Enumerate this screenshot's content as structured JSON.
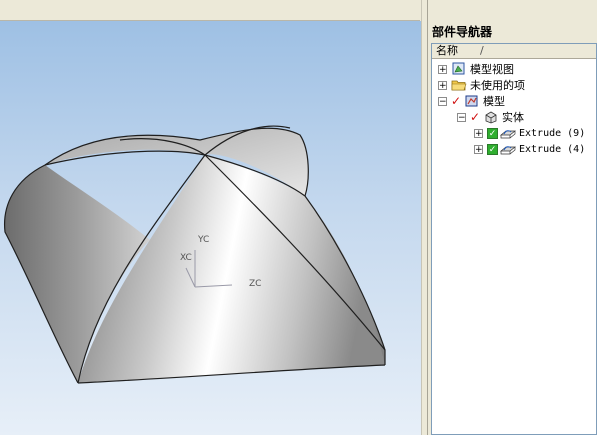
{
  "viewport": {
    "axis_labels": {
      "yc": "YC",
      "xc": "XC",
      "zc": "ZC"
    }
  },
  "navigator": {
    "title": "部件导航器",
    "column_name": "名称",
    "sort_indicator": "/",
    "items": [
      {
        "label": "模型视图",
        "icon": "model-views-icon",
        "expander": "+"
      },
      {
        "label": "未使用的项",
        "icon": "folder-icon",
        "expander": "+"
      },
      {
        "label": "模型",
        "icon": "model-icon",
        "expander": "−"
      },
      {
        "label": "实体",
        "icon": "body-icon",
        "expander": "−"
      },
      {
        "label": "Extrude (9)",
        "icon": "extrude-icon",
        "expander": "+"
      },
      {
        "label": "Extrude (4)",
        "icon": "extrude-icon",
        "expander": "+"
      }
    ]
  },
  "colors": {
    "viewport_top": "#9ec0e4",
    "viewport_bottom": "#e7eff8",
    "check_green": "#2fae2f",
    "check_red": "#d01010"
  }
}
